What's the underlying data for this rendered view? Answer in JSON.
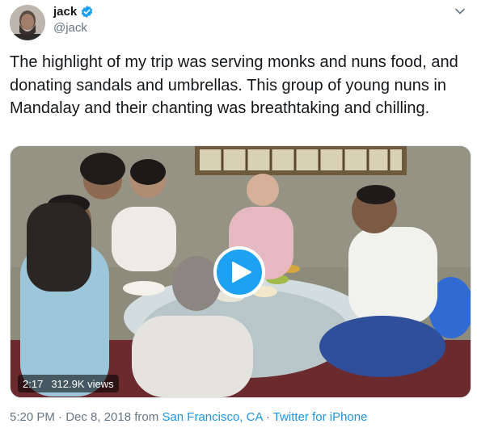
{
  "tweet": {
    "display_name": "jack",
    "handle": "@jack",
    "text": "The highlight of my trip was serving monks and nuns food, and donating sandals and umbrellas. This group of young nuns in Mandalay and their chanting was breathtaking and chilling.",
    "video": {
      "duration": "2:17",
      "views": "312.9K views"
    },
    "timestamp": "5:20 PM · Dec 8, 2018",
    "from_label": "from",
    "location": "San Francisco, CA",
    "separator": "·",
    "source": "Twitter for iPhone"
  },
  "colors": {
    "accent": "#1da1f2",
    "link": "#1b95e0",
    "secondary_text": "#657786"
  },
  "icons": [
    "verified-icon",
    "chevron-down-icon",
    "play-icon"
  ]
}
